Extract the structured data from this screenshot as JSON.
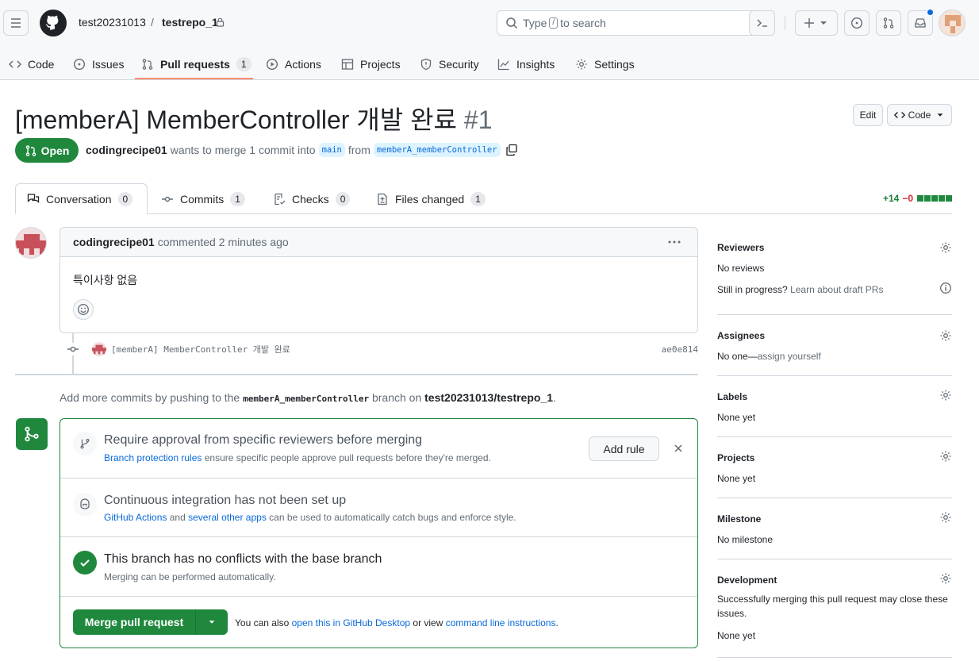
{
  "header": {
    "owner": "test20231013",
    "separator": "/",
    "repo": "testrepo_1",
    "search_prefix": "Type",
    "search_key": "/",
    "search_suffix": "to search"
  },
  "nav": {
    "code": "Code",
    "issues": "Issues",
    "pulls": "Pull requests",
    "pulls_count": "1",
    "actions": "Actions",
    "projects": "Projects",
    "security": "Security",
    "insights": "Insights",
    "settings": "Settings"
  },
  "pr": {
    "title": "[memberA] MemberController 개발 완료",
    "number": "#1",
    "edit_label": "Edit",
    "code_label": "Code",
    "state": "Open",
    "author": "codingrecipe01",
    "merge_text_1": "wants to merge 1 commit into",
    "base_branch": "main",
    "merge_text_2": "from",
    "head_branch": "memberA_memberController"
  },
  "tabs": {
    "conversation": "Conversation",
    "conversation_count": "0",
    "commits": "Commits",
    "commits_count": "1",
    "checks": "Checks",
    "checks_count": "0",
    "files": "Files changed",
    "files_count": "1",
    "additions": "+14",
    "deletions": "−0"
  },
  "comment": {
    "author": "codingrecipe01",
    "time": "commented 2 minutes ago",
    "body": "특이사항 없음"
  },
  "commit": {
    "message": "[memberA] MemberController 개발 완료",
    "sha": "ae0e814"
  },
  "push": {
    "text_1": "Add more commits by pushing to the",
    "branch": "memberA_memberController",
    "text_2": "branch on",
    "repo": "test20231013/testrepo_1",
    "period": "."
  },
  "merge": {
    "rule_title": "Require approval from specific reviewers before merging",
    "rule_link": "Branch protection rules",
    "rule_text": "ensure specific people approve pull requests before they're merged.",
    "add_rule": "Add rule",
    "ci_title": "Continuous integration has not been set up",
    "ci_link_1": "GitHub Actions",
    "ci_and": "and",
    "ci_link_2": "several other apps",
    "ci_text": "can be used to automatically catch bugs and enforce style.",
    "conflict_title": "This branch has no conflicts with the base branch",
    "conflict_sub": "Merging can be performed automatically.",
    "merge_button": "Merge pull request",
    "also_text": "You can also",
    "desktop_link": "open this in GitHub Desktop",
    "or_text": "or view",
    "cli_link": "command line instructions",
    "period": "."
  },
  "sidebar": {
    "reviewers": "Reviewers",
    "no_reviews": "No reviews",
    "in_progress": "Still in progress?",
    "draft_link": "Learn about draft PRs",
    "assignees": "Assignees",
    "no_one": "No one—",
    "assign_self": "assign yourself",
    "labels": "Labels",
    "labels_val": "None yet",
    "projects": "Projects",
    "projects_val": "None yet",
    "milestone": "Milestone",
    "milestone_val": "No milestone",
    "development": "Development",
    "development_text": "Successfully merging this pull request may close these issues.",
    "development_val": "None yet"
  },
  "colors": {
    "accent_green": "#1f883d",
    "link_blue": "#0969da",
    "tab_underline": "#fd8c73"
  }
}
